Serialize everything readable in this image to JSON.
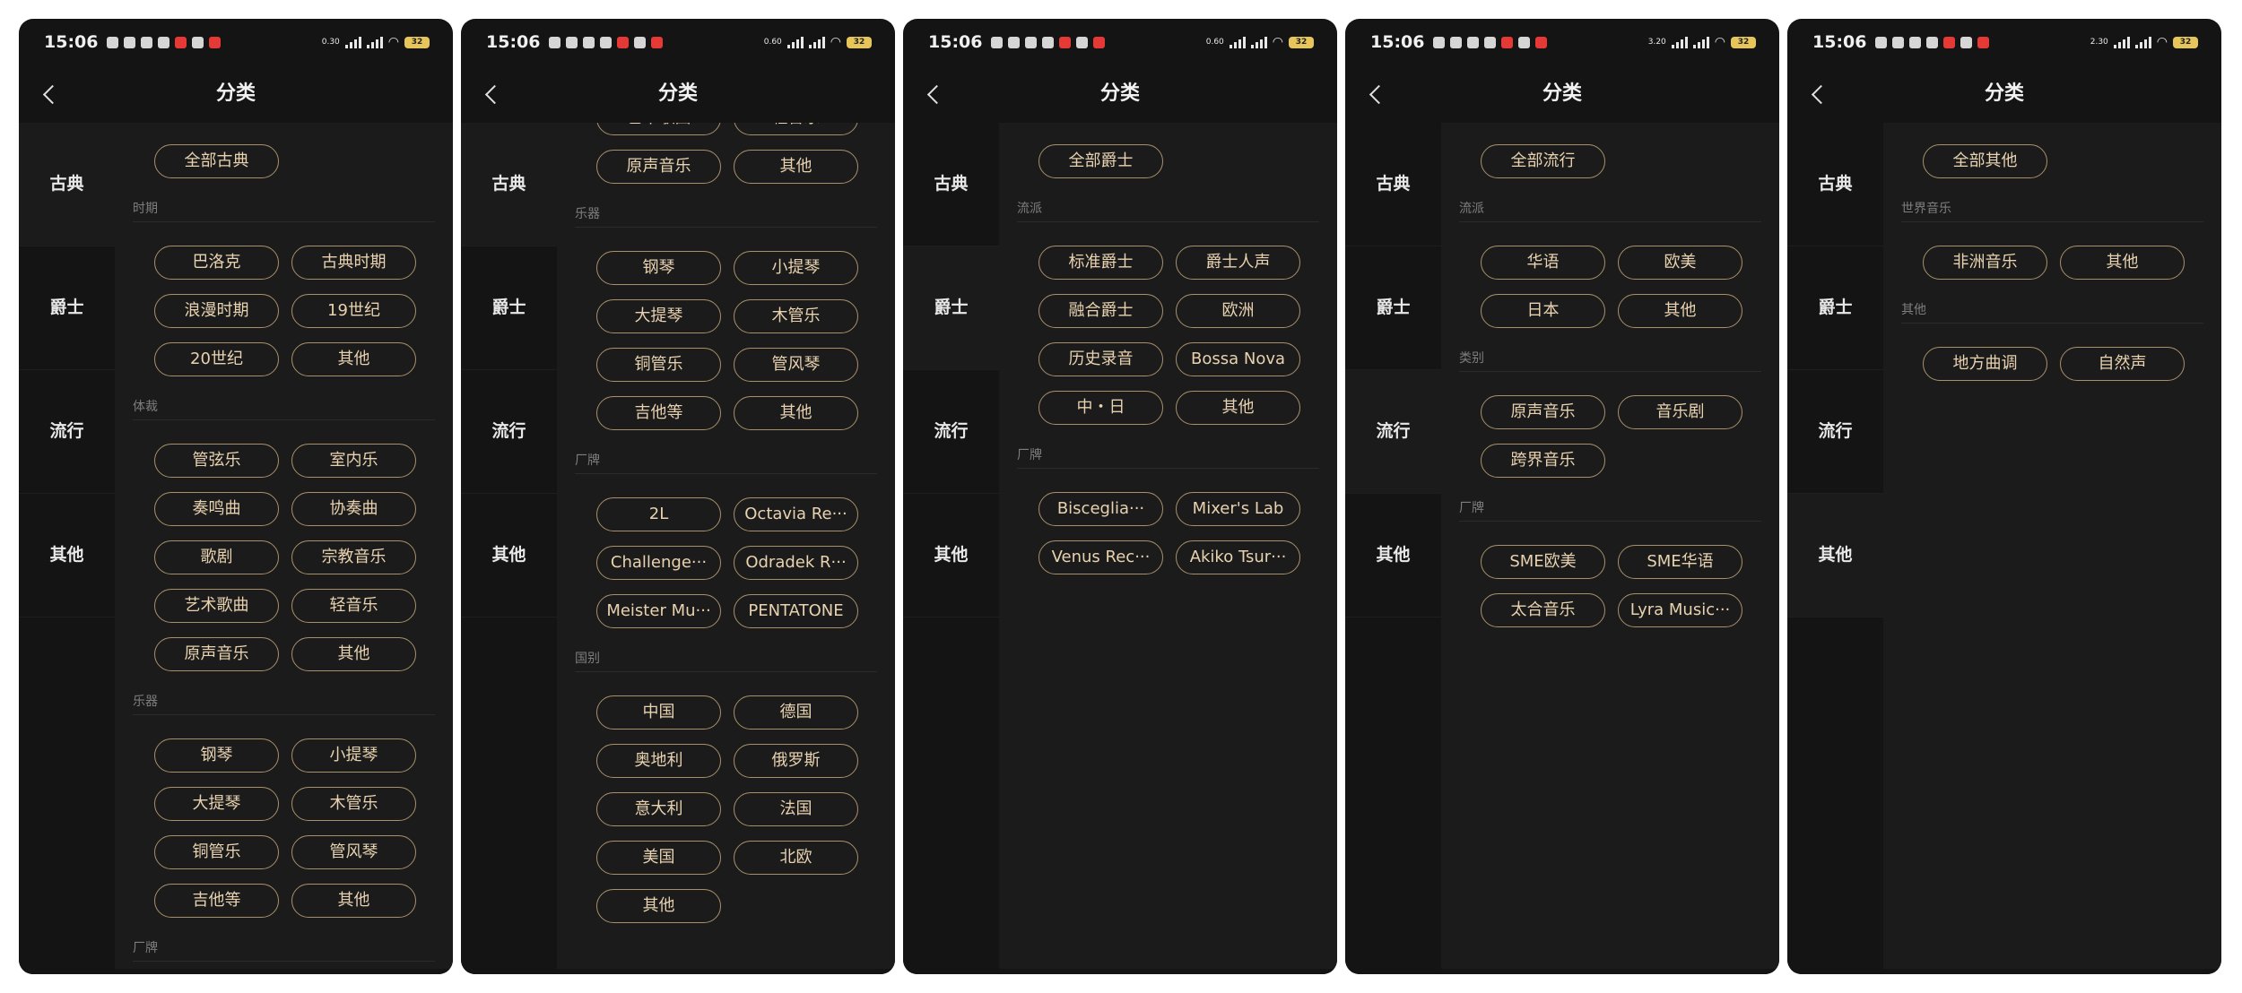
{
  "status": {
    "time": "15:06",
    "speeds": [
      "0.30",
      "0.60",
      "0.60",
      "3.20",
      "2.30"
    ],
    "battery": "32"
  },
  "nav": {
    "title": "分类"
  },
  "sidebar": [
    "古典",
    "爵士",
    "流行",
    "其他"
  ],
  "screens": [
    {
      "active": 0,
      "sections": [
        {
          "chips": [
            "全部古典"
          ],
          "single": true
        },
        {
          "heading": "时期",
          "chips": [
            "巴洛克",
            "古典时期",
            "浪漫时期",
            "19世纪",
            "20世纪",
            "其他"
          ]
        },
        {
          "heading": "体裁",
          "chips": [
            "管弦乐",
            "室内乐",
            "奏鸣曲",
            "协奏曲",
            "歌剧",
            "宗教音乐",
            "艺术歌曲",
            "轻音乐",
            "原声音乐",
            "其他"
          ]
        },
        {
          "heading": "乐器",
          "chips": [
            "钢琴",
            "小提琴",
            "大提琴",
            "木管乐",
            "铜管乐",
            "管风琴",
            "吉他等",
            "其他"
          ]
        },
        {
          "heading": "厂牌",
          "chips": []
        }
      ]
    },
    {
      "active": 0,
      "sections": [
        {
          "chips": [
            "艺术歌曲",
            "轻音乐",
            "原声音乐",
            "其他"
          ]
        },
        {
          "heading": "乐器",
          "chips": [
            "钢琴",
            "小提琴",
            "大提琴",
            "木管乐",
            "铜管乐",
            "管风琴",
            "吉他等",
            "其他"
          ]
        },
        {
          "heading": "厂牌",
          "chips": [
            "2L",
            "Octavia Re···",
            "Challenge···",
            "Odradek R···",
            "Meister Mu···",
            "PENTATONE"
          ]
        },
        {
          "heading": "国别",
          "chips": [
            "中国",
            "德国",
            "奥地利",
            "俄罗斯",
            "意大利",
            "法国",
            "美国",
            "北欧",
            "其他"
          ]
        }
      ]
    },
    {
      "active": 1,
      "sections": [
        {
          "chips": [
            "全部爵士"
          ],
          "single": true
        },
        {
          "heading": "流派",
          "chips": [
            "标准爵士",
            "爵士人声",
            "融合爵士",
            "欧洲",
            "历史录音",
            "Bossa Nova",
            "中・日",
            "其他"
          ]
        },
        {
          "heading": "厂牌",
          "chips": [
            "Bisceglia···",
            "Mixer's Lab",
            "Venus Rec···",
            "Akiko Tsur···"
          ]
        }
      ]
    },
    {
      "active": 2,
      "sections": [
        {
          "chips": [
            "全部流行"
          ],
          "single": true
        },
        {
          "heading": "流派",
          "chips": [
            "华语",
            "欧美",
            "日本",
            "其他"
          ]
        },
        {
          "heading": "类别",
          "chips": [
            "原声音乐",
            "音乐剧",
            "跨界音乐"
          ]
        },
        {
          "heading": "厂牌",
          "chips": [
            "SME欧美",
            "SME华语",
            "太合音乐",
            "Lyra Music···"
          ]
        }
      ]
    },
    {
      "active": 3,
      "sections": [
        {
          "chips": [
            "全部其他"
          ],
          "single": true
        },
        {
          "heading": "世界音乐",
          "chips": [
            "非洲音乐",
            "其他"
          ]
        },
        {
          "heading": "其他",
          "chips": [
            "地方曲调",
            "自然声"
          ]
        }
      ]
    }
  ]
}
